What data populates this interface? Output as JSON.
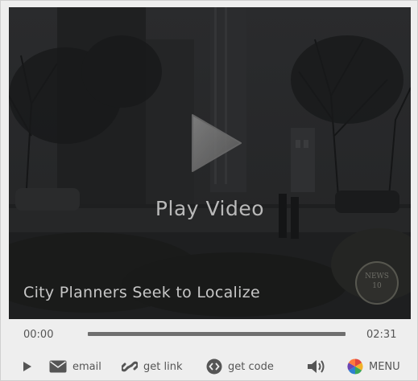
{
  "player": {
    "play_label": "Play Video",
    "caption": "City Planners Seek to Localize",
    "watermark_text": "NEWS10",
    "current_time": "00:00",
    "total_time": "02:31",
    "progress_fraction": 0.0
  },
  "toolbar": {
    "email_label": "email",
    "link_label": "get link",
    "code_label": "get code",
    "menu_label": "MENU"
  },
  "colors": {
    "background": "#eeeeee",
    "text": "#555555",
    "track": "#6e6e6e",
    "video_dark": "#1c1d1e"
  },
  "icons": [
    "play-icon",
    "email-icon",
    "link-icon",
    "code-icon",
    "volume-icon",
    "menu-icon"
  ]
}
